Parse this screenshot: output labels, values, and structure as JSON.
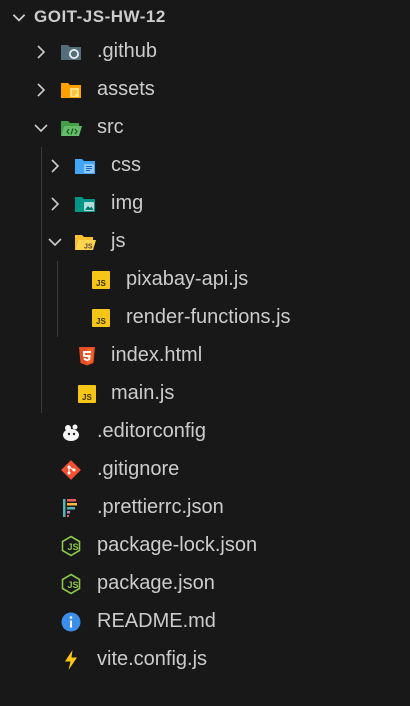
{
  "explorer": {
    "root": {
      "label": "GOIT-JS-HW-12",
      "expanded": true
    },
    "items": [
      {
        "label": ".github",
        "kind": "folder",
        "expanded": false,
        "icon": "github-folder-icon"
      },
      {
        "label": "assets",
        "kind": "folder",
        "expanded": false,
        "icon": "assets-folder-icon"
      },
      {
        "label": "src",
        "kind": "folder",
        "expanded": true,
        "icon": "src-folder-open-icon"
      },
      {
        "label": "css",
        "kind": "folder",
        "expanded": false,
        "icon": "css-folder-icon"
      },
      {
        "label": "img",
        "kind": "folder",
        "expanded": false,
        "icon": "images-folder-icon"
      },
      {
        "label": "js",
        "kind": "folder",
        "expanded": true,
        "icon": "js-folder-open-icon"
      },
      {
        "label": "pixabay-api.js",
        "kind": "file",
        "icon": "javascript-file-icon"
      },
      {
        "label": "render-functions.js",
        "kind": "file",
        "icon": "javascript-file-icon"
      },
      {
        "label": "index.html",
        "kind": "file",
        "icon": "html5-file-icon"
      },
      {
        "label": "main.js",
        "kind": "file",
        "icon": "javascript-file-icon"
      },
      {
        "label": ".editorconfig",
        "kind": "file",
        "icon": "editorconfig-file-icon"
      },
      {
        "label": ".gitignore",
        "kind": "file",
        "icon": "git-file-icon"
      },
      {
        "label": ".prettierrc.json",
        "kind": "file",
        "icon": "prettier-file-icon"
      },
      {
        "label": "package-lock.json",
        "kind": "file",
        "icon": "nodejs-file-icon"
      },
      {
        "label": "package.json",
        "kind": "file",
        "icon": "nodejs-file-icon"
      },
      {
        "label": "README.md",
        "kind": "file",
        "icon": "info-file-icon"
      },
      {
        "label": "vite.config.js",
        "kind": "file",
        "icon": "vite-file-icon"
      }
    ]
  },
  "colors": {
    "background": "#181818",
    "text": "#cccccc",
    "javascript": "#f5c518",
    "html": "#e44d26",
    "git": "#f05133",
    "nodejs": "#8cc84b",
    "info": "#3b8eea",
    "vite": "#ffc517"
  }
}
